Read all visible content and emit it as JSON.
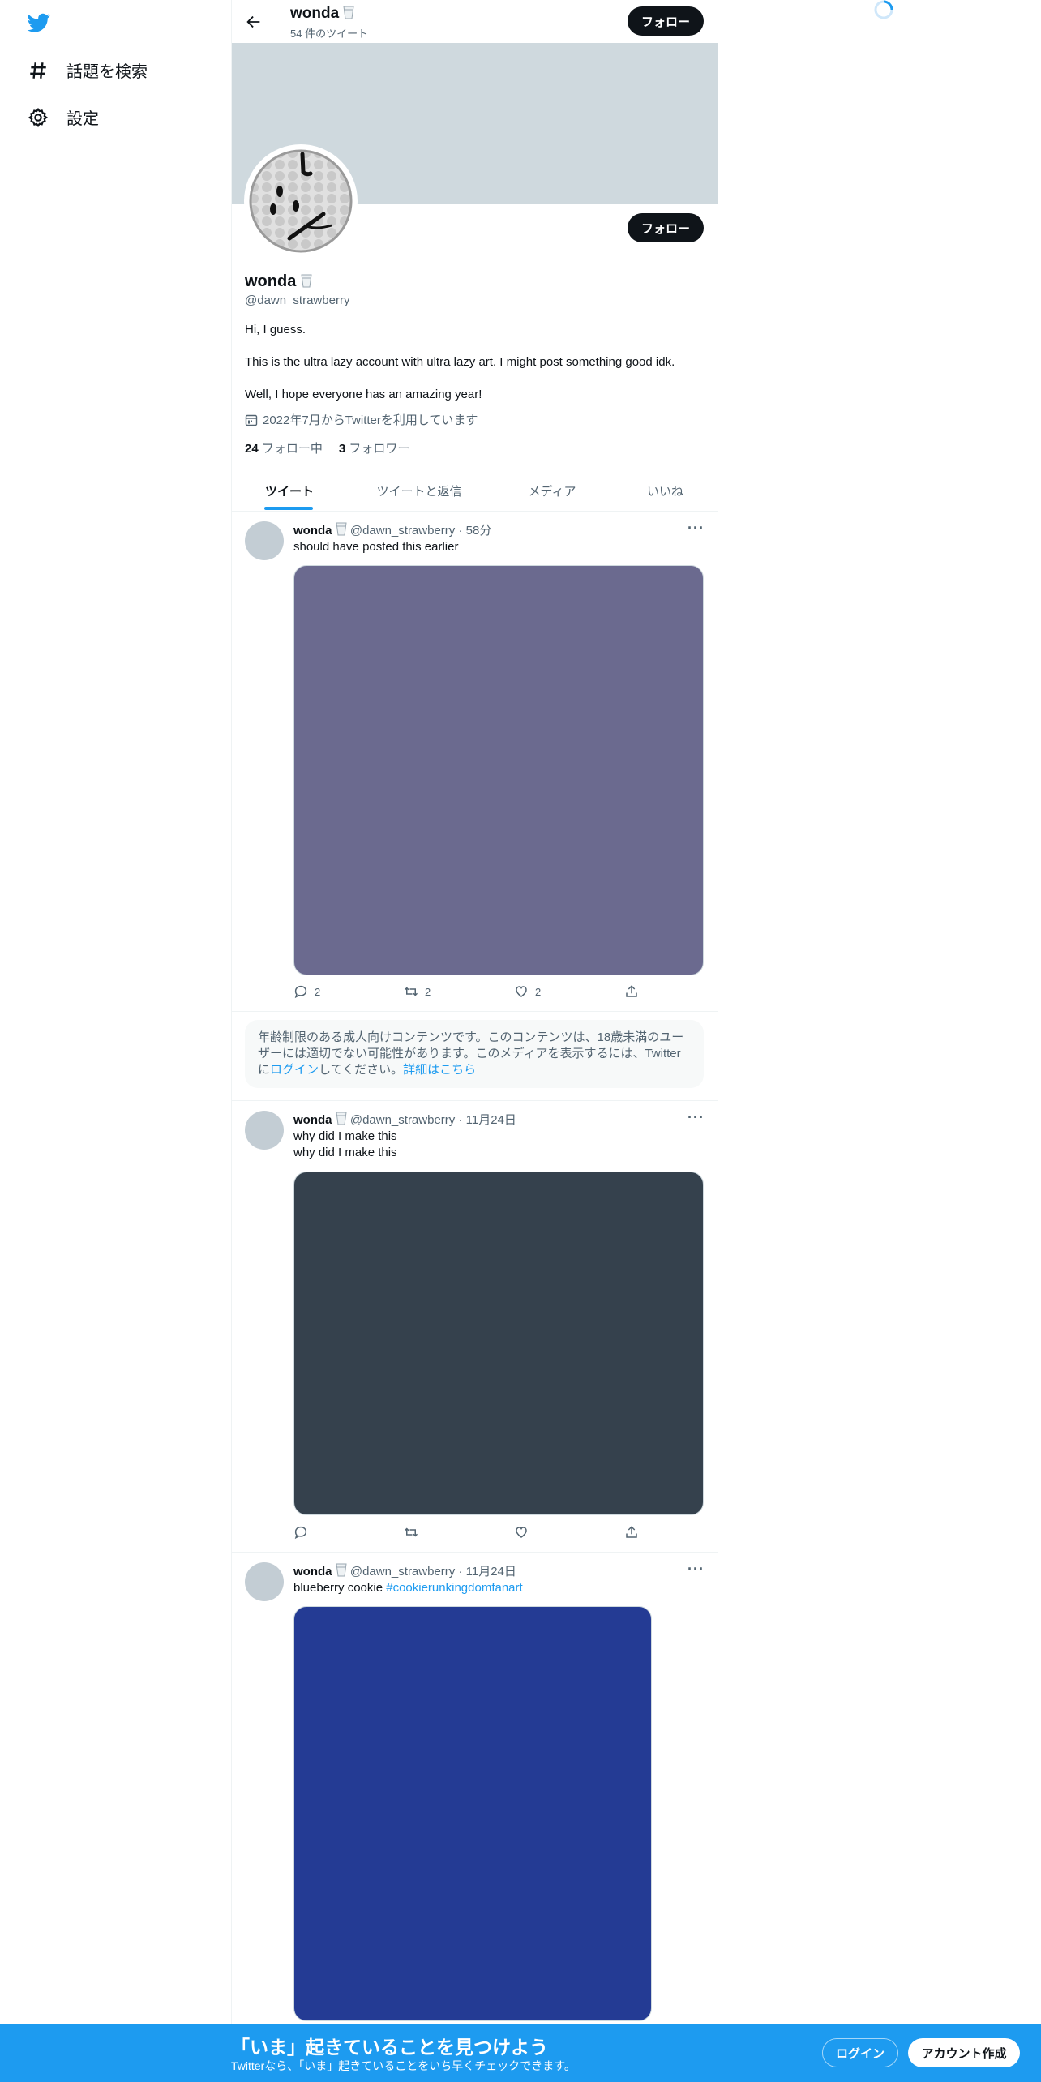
{
  "nav": {
    "explore_label": "話題を検索",
    "settings_label": "設定"
  },
  "header": {
    "name": "wonda",
    "tweet_count": "54 件のツイート",
    "follow_label": "フォロー"
  },
  "profile": {
    "name": "wonda",
    "handle": "@dawn_strawberry",
    "follow_label": "フォロー",
    "bio_line1": "Hi, I guess.",
    "bio_line2": "This is the ultra lazy account with ultra lazy art. I might post something good idk.",
    "bio_line3": "Well, I hope everyone has an amazing year!",
    "joined": "2022年7月からTwitterを利用しています",
    "following_count": "24",
    "following_label": "フォロー中",
    "followers_count": "3",
    "followers_label": "フォロワー",
    "banner_color": "#cfd9de"
  },
  "tabs": [
    "ツイート",
    "ツイートと返信",
    "メディア",
    "いいね"
  ],
  "tweets": [
    {
      "name": "wonda",
      "handle": "@dawn_strawberry",
      "sep": "·",
      "time": "58分",
      "text": "should have posted this earlier",
      "media_color": "#6b6a8f",
      "reply_count": "2",
      "retweet_count": "2",
      "like_count": "2"
    },
    {
      "name": "wonda",
      "handle": "@dawn_strawberry",
      "sep": "·",
      "time": "11月24日",
      "text1": "why did I make this",
      "text2": "why did I make this",
      "media_color": "#35414d"
    },
    {
      "name": "wonda",
      "handle": "@dawn_strawberry",
      "sep": "·",
      "time": "11月24日",
      "text": "blueberry cookie ",
      "hashtag": "#cookierunkingdomfanart",
      "media_color": "#243b94"
    }
  ],
  "sensitive_notice": {
    "text_part1": "年齢制限のある成人向けコンテンツです。このコンテンツは、18歳未満のユーザーには適切でない可能性があります。このメディアを表示するには、Twitterに",
    "login_link": "ログイン",
    "text_part2": "してください。",
    "details_link": "詳細はこちら"
  },
  "banner": {
    "title": "「いま」起きていることを見つけよう",
    "subtitle": "Twitterなら、「いま」起きていることをいち早くチェックできます。",
    "login_label": "ログイン",
    "signup_label": "アカウント作成"
  },
  "colors": {
    "accent": "#1d9bf0",
    "text": "#0f1419",
    "secondary": "#536471"
  }
}
